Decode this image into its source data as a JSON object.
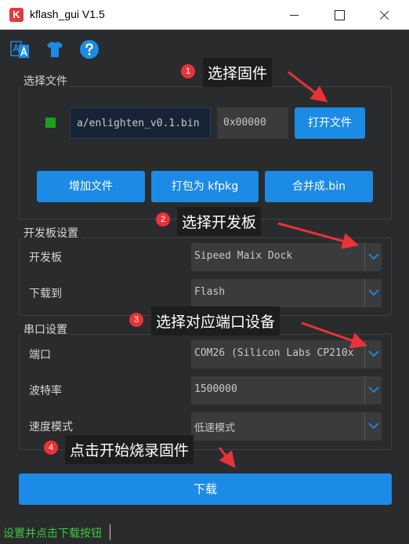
{
  "window": {
    "title": "kflash_gui V1.5",
    "logo_letter": "K"
  },
  "toolbar": {
    "icons": [
      "language-icon",
      "tshirt-icon",
      "help-icon"
    ]
  },
  "file_group": {
    "title": "选择文件",
    "file_path": "a/enlighten_v0.1.bin",
    "address": "0x00000",
    "open_label": "打开文件",
    "add_file_label": "增加文件",
    "pack_label": "打包为 kfpkg",
    "merge_label": "合并成.bin"
  },
  "board_group": {
    "title": "开发板设置",
    "board_label": "开发板",
    "board_value": "Sipeed Maix Dock",
    "download_to_label": "下载到",
    "download_to_value": "Flash"
  },
  "serial_group": {
    "title": "串口设置",
    "port_label": "端口",
    "port_value": "COM26 (Silicon Labs CP210x",
    "baud_label": "波特率",
    "baud_value": "1500000",
    "speed_label": "速度模式",
    "speed_value": "低速模式"
  },
  "download_button": "下载",
  "status_text": "设置并点击下载按钮",
  "annotations": [
    {
      "num": "1",
      "text": "选择固件"
    },
    {
      "num": "2",
      "text": "选择开发板"
    },
    {
      "num": "3",
      "text": "选择对应端口设备"
    },
    {
      "num": "4",
      "text": "点击开始烧录固件"
    }
  ],
  "colors": {
    "background": "#2a2b2d",
    "accent": "#1c8be5",
    "file_status": "#1aa01a",
    "annotation_red": "#e8333a",
    "status_green": "#3ec93e"
  }
}
